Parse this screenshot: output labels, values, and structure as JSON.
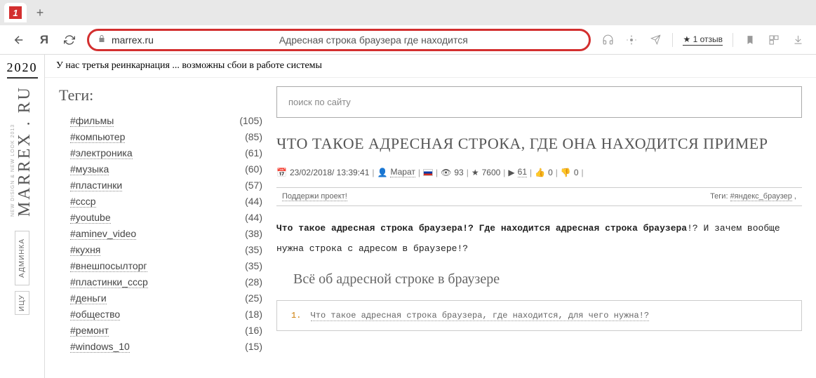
{
  "browser": {
    "url": "marrex.ru",
    "address_label": "Адресная строка браузера где находится",
    "reviews": "★ 1 отзыв",
    "new_tab": "+"
  },
  "page": {
    "year": "2020",
    "logo": "MARREX . RU",
    "tagline": "NEW DISIGN & NEW LOOK 2013",
    "notice": "У нас третья реинкарнация ... возможны сбои в работе системы",
    "side_buttons": [
      "АДМИНКА",
      "ИЦУ"
    ]
  },
  "sidebar": {
    "title": "Теги:",
    "tags": [
      {
        "label": "#фильмы",
        "count": "(105)"
      },
      {
        "label": "#компьютер",
        "count": "(85)"
      },
      {
        "label": "#электроника",
        "count": "(61)"
      },
      {
        "label": "#музыка",
        "count": "(60)"
      },
      {
        "label": "#пластинки",
        "count": "(57)"
      },
      {
        "label": "#ссср",
        "count": "(44)"
      },
      {
        "label": "#youtube",
        "count": "(44)"
      },
      {
        "label": "#aminev_video",
        "count": "(38)"
      },
      {
        "label": "#кухня",
        "count": "(35)"
      },
      {
        "label": "#внешпосылторг",
        "count": "(35)"
      },
      {
        "label": "#пластинки_ссср",
        "count": "(28)"
      },
      {
        "label": "#деньги",
        "count": "(25)"
      },
      {
        "label": "#общество",
        "count": "(18)"
      },
      {
        "label": "#ремонт",
        "count": "(16)"
      },
      {
        "label": "#windows_10",
        "count": "(15)"
      }
    ]
  },
  "content": {
    "search_placeholder": "поиск по сайту",
    "title": "ЧТО ТАКОЕ АДРЕСНАЯ СТРОКА, ГДЕ ОНА НАХОДИТСЯ ПРИМЕР",
    "meta": {
      "date": "23/02/2018/ 13:39:41",
      "author": "Марат",
      "views": "93",
      "stars": "7600",
      "yt": "61",
      "likes": "0",
      "dislikes": "0"
    },
    "support": "Поддержи проект!",
    "tags_label": "Теги:",
    "article_tag": "#яндекс_браузер",
    "body_bold": "Что такое адресная строка браузера!? Где находится адресная строка браузера",
    "body_rest": "!? И зачем вообще нужна строка с адресом в браузере!?",
    "subheading": "Всё об адресной строке в браузере",
    "toc_num": "1.",
    "toc_item": "Что такое адресная строка браузера, где находится, для чего нужна!?"
  }
}
